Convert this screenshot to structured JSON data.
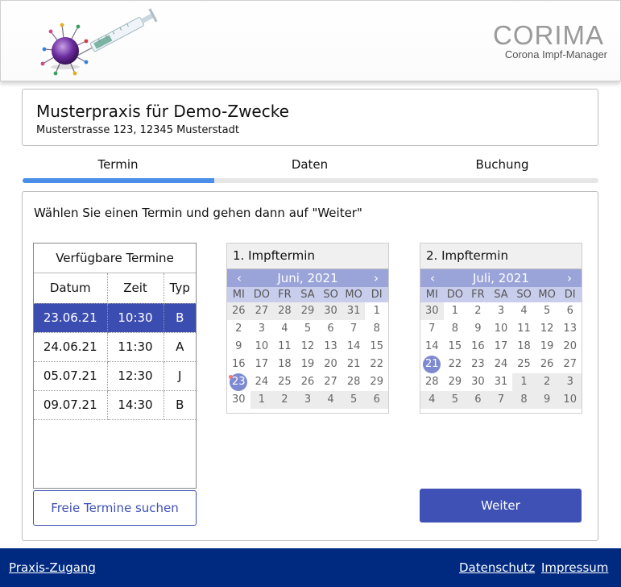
{
  "header": {
    "brand_name": "CORIMA",
    "brand_subtitle": "Corona Impf-Manager"
  },
  "practice": {
    "name": "Musterpraxis für Demo-Zwecke",
    "address": "Musterstrasse 123, 12345 Musterstadt"
  },
  "steps": {
    "items": [
      "Termin",
      "Daten",
      "Buchung"
    ],
    "progress_fraction": 0.333
  },
  "instruction": "Wählen Sie einen Termin und gehen dann auf \"Weiter\"",
  "appointments": {
    "title": "Verfügbare Termine",
    "columns": [
      "Datum",
      "Zeit",
      "Typ"
    ],
    "rows": [
      {
        "date": "23.06.21",
        "time": "10:30",
        "type": "B",
        "selected": true
      },
      {
        "date": "24.06.21",
        "time": "11:30",
        "type": "A",
        "selected": false
      },
      {
        "date": "05.07.21",
        "time": "12:30",
        "type": "J",
        "selected": false
      },
      {
        "date": "09.07.21",
        "time": "14:30",
        "type": "B",
        "selected": false
      }
    ]
  },
  "buttons": {
    "search": "Freie Termine suchen",
    "next": "Weiter"
  },
  "weekdays": [
    "MI",
    "DO",
    "FR",
    "SA",
    "SO",
    "MO",
    "DI"
  ],
  "calendars": [
    {
      "title": "1. Impftermin",
      "month": "Juni, 2021",
      "prev_glyph": "‹",
      "next_glyph": "›",
      "selected_day": "23",
      "days": [
        {
          "d": "26",
          "o": true
        },
        {
          "d": "27",
          "o": true
        },
        {
          "d": "28",
          "o": true
        },
        {
          "d": "29",
          "o": true
        },
        {
          "d": "30",
          "o": true
        },
        {
          "d": "31",
          "o": true
        },
        {
          "d": "1"
        },
        {
          "d": "2"
        },
        {
          "d": "3"
        },
        {
          "d": "4"
        },
        {
          "d": "5"
        },
        {
          "d": "6"
        },
        {
          "d": "7"
        },
        {
          "d": "8"
        },
        {
          "d": "9"
        },
        {
          "d": "10"
        },
        {
          "d": "11"
        },
        {
          "d": "12"
        },
        {
          "d": "13"
        },
        {
          "d": "14"
        },
        {
          "d": "15"
        },
        {
          "d": "16"
        },
        {
          "d": "17"
        },
        {
          "d": "18"
        },
        {
          "d": "19"
        },
        {
          "d": "20"
        },
        {
          "d": "21"
        },
        {
          "d": "22"
        },
        {
          "d": "23",
          "sel": true,
          "dot": true
        },
        {
          "d": "24"
        },
        {
          "d": "25"
        },
        {
          "d": "26"
        },
        {
          "d": "27"
        },
        {
          "d": "28"
        },
        {
          "d": "29"
        },
        {
          "d": "30"
        },
        {
          "d": "1",
          "o": true
        },
        {
          "d": "2",
          "o": true
        },
        {
          "d": "3",
          "o": true
        },
        {
          "d": "4",
          "o": true
        },
        {
          "d": "5",
          "o": true
        },
        {
          "d": "6",
          "o": true
        }
      ]
    },
    {
      "title": "2. Impftermin",
      "month": "Juli, 2021",
      "prev_glyph": "‹",
      "next_glyph": "›",
      "selected_day": "21",
      "days": [
        {
          "d": "30",
          "o": true
        },
        {
          "d": "1"
        },
        {
          "d": "2"
        },
        {
          "d": "3"
        },
        {
          "d": "4"
        },
        {
          "d": "5"
        },
        {
          "d": "6"
        },
        {
          "d": "7"
        },
        {
          "d": "8"
        },
        {
          "d": "9"
        },
        {
          "d": "10"
        },
        {
          "d": "11"
        },
        {
          "d": "12"
        },
        {
          "d": "13"
        },
        {
          "d": "14"
        },
        {
          "d": "15"
        },
        {
          "d": "16"
        },
        {
          "d": "17"
        },
        {
          "d": "18"
        },
        {
          "d": "19"
        },
        {
          "d": "20"
        },
        {
          "d": "21",
          "sel": true
        },
        {
          "d": "22"
        },
        {
          "d": "23"
        },
        {
          "d": "24"
        },
        {
          "d": "25"
        },
        {
          "d": "26"
        },
        {
          "d": "27"
        },
        {
          "d": "28"
        },
        {
          "d": "29"
        },
        {
          "d": "30"
        },
        {
          "d": "31"
        },
        {
          "d": "1",
          "o": true
        },
        {
          "d": "2",
          "o": true
        },
        {
          "d": "3",
          "o": true
        },
        {
          "d": "4",
          "o": true
        },
        {
          "d": "5",
          "o": true
        },
        {
          "d": "6",
          "o": true
        },
        {
          "d": "7",
          "o": true
        },
        {
          "d": "8",
          "o": true
        },
        {
          "d": "9",
          "o": true
        },
        {
          "d": "10",
          "o": true
        }
      ]
    }
  ],
  "footer": {
    "left_link": "Praxis-Zugang",
    "privacy_link": "Datenschutz",
    "imprint_link": "Impressum"
  },
  "colors": {
    "primary": "#3f51b5",
    "footer_bg": "#002a80",
    "progress": "#4a8ee8",
    "calendar_nav": "#9aa4d9"
  },
  "icons": [
    "virus-syringe-logo",
    "chevron-left-icon",
    "chevron-right-icon"
  ]
}
